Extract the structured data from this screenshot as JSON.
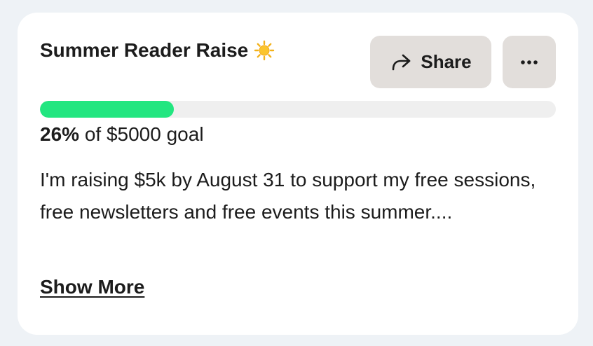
{
  "card": {
    "title": "Summer Reader Raise",
    "title_emoji_icon": "sun-icon",
    "share_button": {
      "label": "Share",
      "icon": "share-arrow-icon"
    },
    "more_button": {
      "icon": "ellipsis-icon"
    },
    "progress": {
      "percent": 26,
      "percent_label": "26%",
      "goal_text": " of $5000 goal",
      "fill_color": "#22e680",
      "track_color": "#efefef"
    },
    "description": "I'm raising $5k by August 31 to support my free sessions, free newsletters and free events this summer....",
    "show_more_label": "Show More"
  },
  "colors": {
    "page_background": "#eef2f6",
    "card_background": "#ffffff",
    "button_background": "#e2dedb",
    "text": "#1c1c1c"
  }
}
